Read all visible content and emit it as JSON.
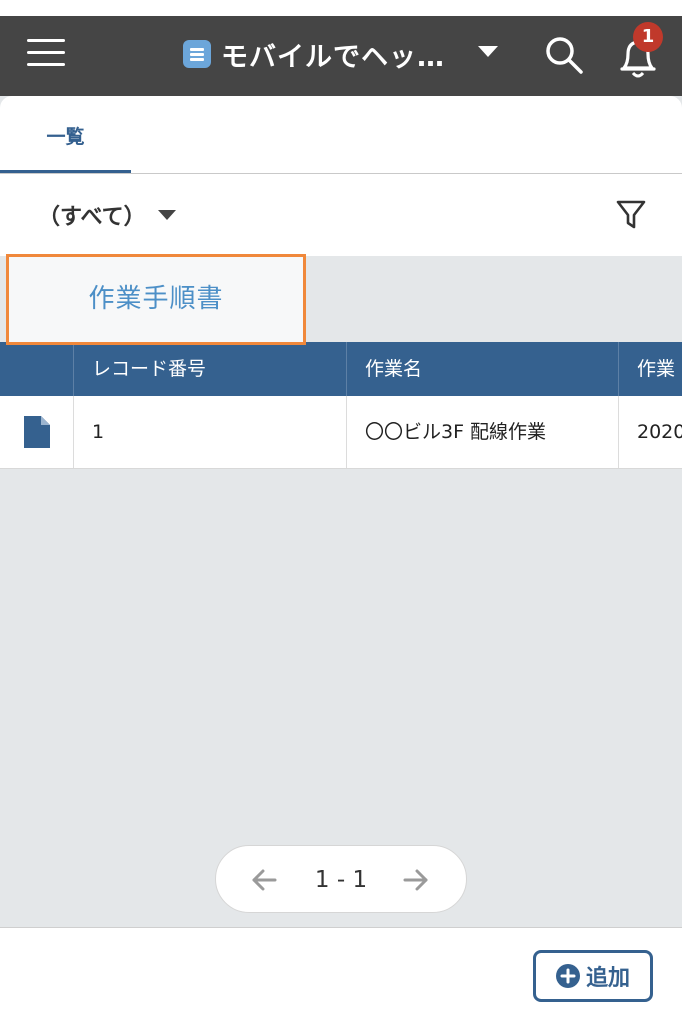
{
  "header": {
    "app_title": "モバイルでヘッ…",
    "notification_count": "1"
  },
  "tabs": [
    {
      "label": "一覧",
      "active": true
    }
  ],
  "view": {
    "selected": "（すべて）"
  },
  "highlight": {
    "label": "作業手順書"
  },
  "table": {
    "columns": [
      "",
      "レコード番号",
      "作業名",
      "作業"
    ],
    "rows": [
      {
        "record_no": "1",
        "name": "〇〇ビル3F 配線作業",
        "extra": "2020"
      }
    ]
  },
  "pagination": {
    "range": "1 - 1"
  },
  "footer": {
    "add_label": "追加"
  },
  "colors": {
    "header_bg": "#454545",
    "accent": "#35618f",
    "highlight_border": "#f0883b",
    "badge": "#c0392b"
  },
  "icons": [
    "menu-icon",
    "app-list-icon",
    "chevron-down-icon",
    "search-icon",
    "bell-icon",
    "filter-icon",
    "document-icon",
    "arrow-left-icon",
    "arrow-right-icon",
    "plus-circle-icon"
  ]
}
